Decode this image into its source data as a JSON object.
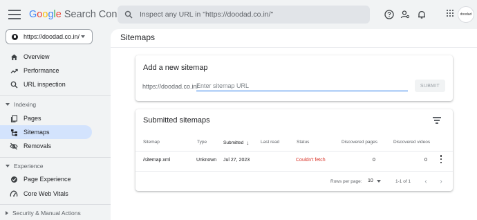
{
  "header": {
    "logo_google": "Google",
    "logo_product": "Search Console",
    "search_placeholder": "Inspect any URL in \"https://doodad.co.in/\"",
    "avatar_text": "doodad"
  },
  "property_selector": {
    "value": "https://doodad.co.in/"
  },
  "sidebar": {
    "overview": "Overview",
    "performance": "Performance",
    "url_inspection": "URL inspection",
    "group_indexing": "Indexing",
    "pages": "Pages",
    "sitemaps": "Sitemaps",
    "removals": "Removals",
    "group_experience": "Experience",
    "page_experience": "Page Experience",
    "core_web_vitals": "Core Web Vitals",
    "group_security": "Security & Manual Actions"
  },
  "page": {
    "title": "Sitemaps"
  },
  "add_sitemap": {
    "title": "Add a new sitemap",
    "prefix": "https://doodad.co.in/",
    "input_placeholder": "Enter sitemap URL",
    "submit_label": "SUBMIT"
  },
  "submitted": {
    "title": "Submitted sitemaps",
    "columns": [
      "Sitemap",
      "Type",
      "Submitted",
      "Last read",
      "Status",
      "Discovered pages",
      "Discovered videos"
    ],
    "rows": [
      {
        "sitemap": "/sitemap.xml",
        "type": "Unknown",
        "submitted": "Jul 27, 2023",
        "last_read": "",
        "status": "Couldn't fetch",
        "discovered_pages": "0",
        "discovered_videos": "0"
      }
    ],
    "rows_per_page_label": "Rows per page:",
    "rows_per_page_value": "10",
    "range_label": "1-1 of 1"
  },
  "colors": {
    "accent": "#1a73e8",
    "error": "#d93025",
    "active_nav": "#d3e3fd"
  }
}
